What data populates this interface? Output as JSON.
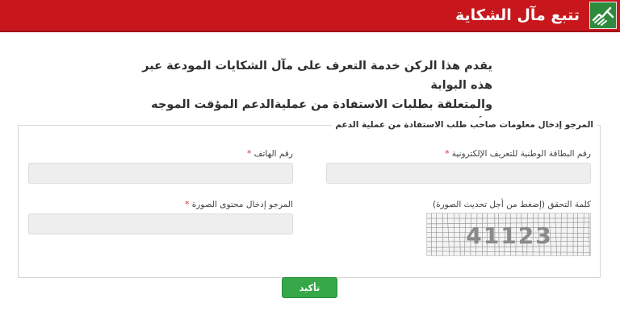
{
  "header": {
    "title": "تتبع مآل الشكاية",
    "icon": "handshake-icon",
    "background_color": "#c8171c",
    "icon_background_color": "#2e8b3d"
  },
  "intro": {
    "line1": "يقدم هذا الركن خدمة التعرف على مآل الشكايات المودعة عبر هذه البوابة",
    "line2": "والمتعلقة بطلبات الاستفادة من عمليةالدعم المؤقت الموجه للأسر المعنية."
  },
  "form": {
    "legend": "المرجو إدخال معلومات صاحب طلب الاستفادة من عملية الدعم",
    "national_id": {
      "label": "رقم البطاقة الوطنية للتعريف الإلكترونية",
      "required_mark": "*",
      "value": ""
    },
    "phone": {
      "label": "رقم الهاتف",
      "required_mark": "*",
      "value": ""
    },
    "captcha": {
      "label": "كلمة التحقق (إضغط من أجل تحديث الصورة)",
      "code": "41123"
    },
    "captcha_input": {
      "label": "المرجو إدخال محتوى الصورة",
      "required_mark": "*",
      "value": ""
    },
    "submit_label": "تأكيد",
    "submit_color": "#36a84a"
  }
}
